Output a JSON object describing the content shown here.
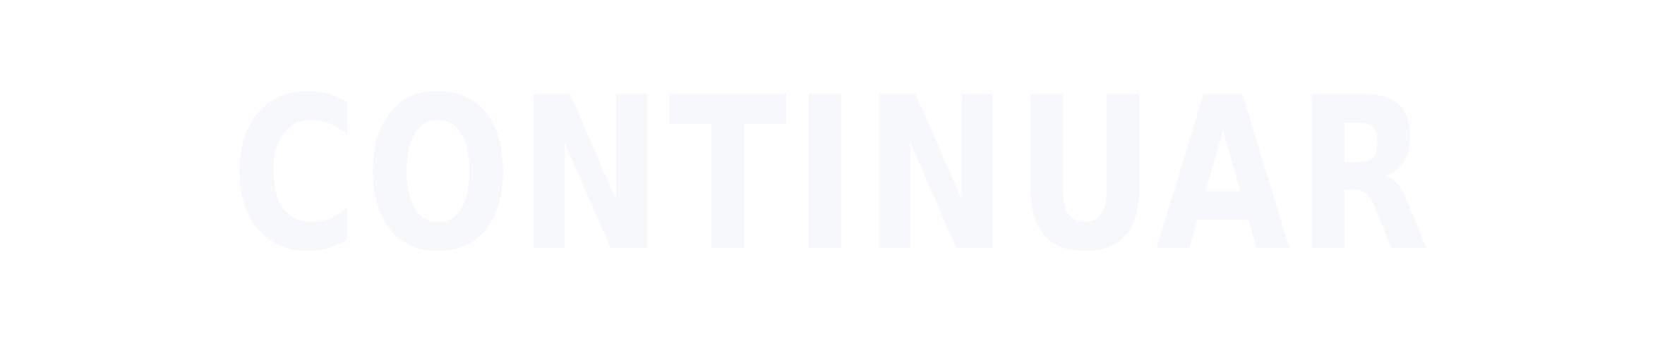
{
  "button": {
    "label": "CONTINUAR"
  },
  "colors": {
    "background": "#ffffff",
    "text": "#f7f8fc"
  }
}
